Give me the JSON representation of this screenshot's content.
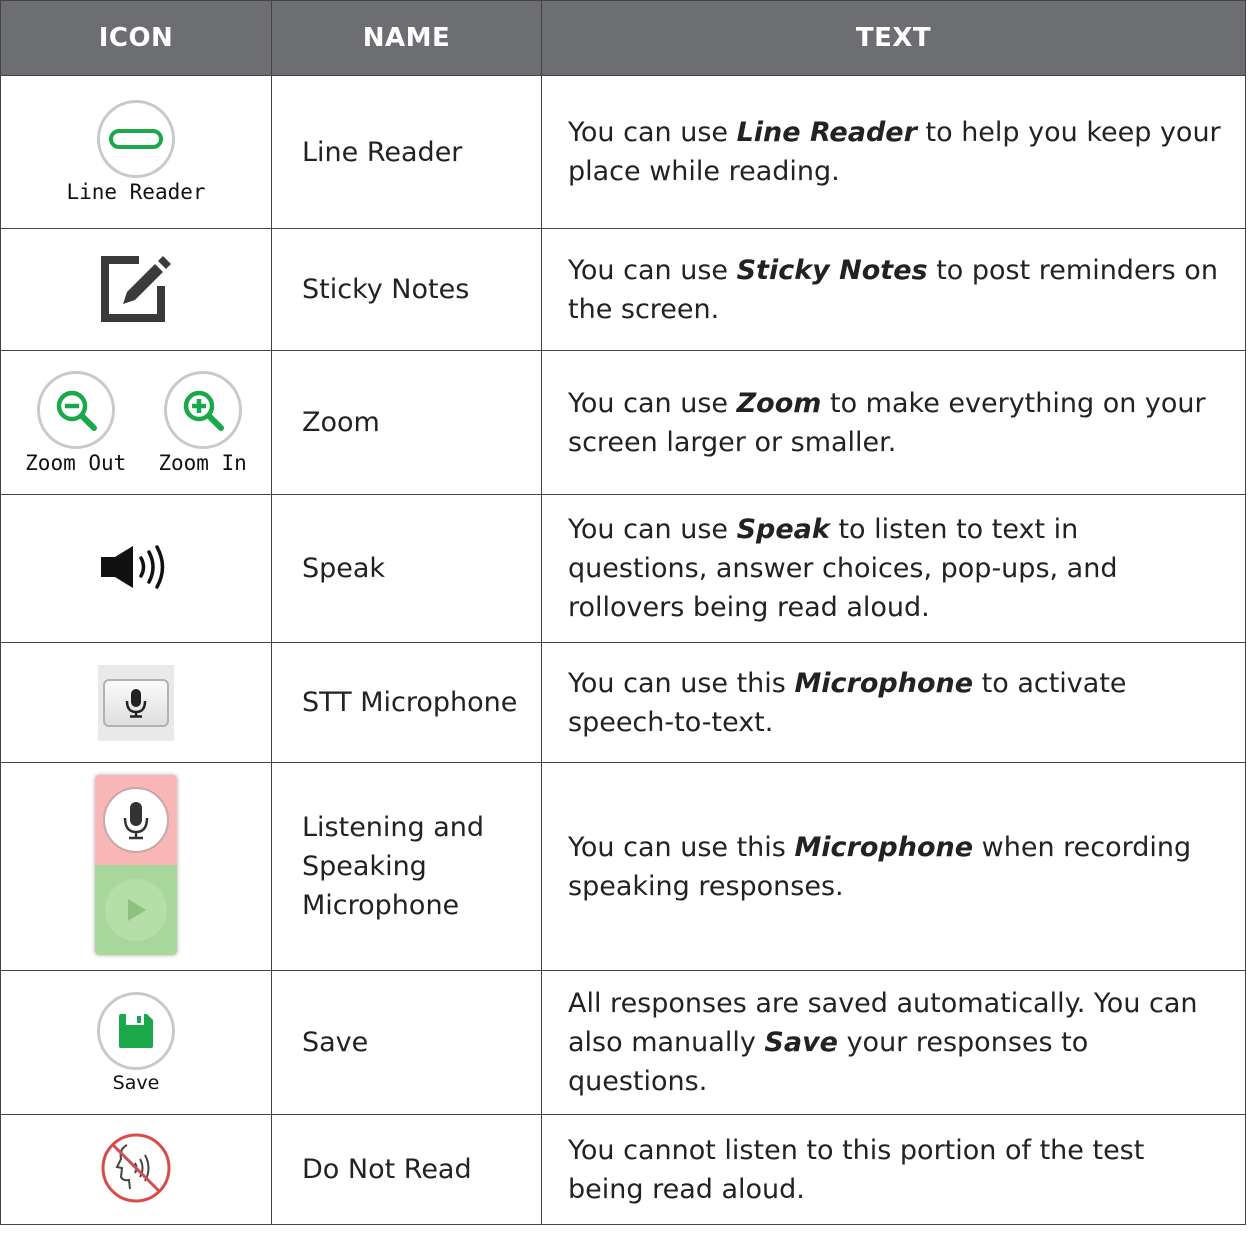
{
  "header": {
    "icon": "ICON",
    "name": "NAME",
    "text": "TEXT"
  },
  "colors": {
    "header_bg": "#6d6e71",
    "green": "#1aa84b",
    "border": "#444444"
  },
  "rows": [
    {
      "icon": "line-reader-icon",
      "icon_caption": "Line Reader",
      "name": "Line Reader",
      "text_before": "You can use ",
      "text_bold": "Line Reader",
      "text_after": " to help you keep your place while reading."
    },
    {
      "icon": "edit-pencil-icon",
      "name": "Sticky Notes",
      "text_before": "You can use ",
      "text_bold": "Sticky Notes",
      "text_after": " to post reminders on the screen."
    },
    {
      "icon": "zoom-icons",
      "icon_caption_left": "Zoom Out",
      "icon_caption_right": "Zoom In",
      "name": "Zoom",
      "text_before": "You can use ",
      "text_bold": "Zoom",
      "text_after": " to make everything on your screen larger or smaller."
    },
    {
      "icon": "speaker-icon",
      "name": "Speak",
      "text_before": "You can use ",
      "text_bold": "Speak",
      "text_after": " to listen to text in questions, answer choices, pop-ups, and rollovers being read aloud."
    },
    {
      "icon": "microphone-icon",
      "name": "STT Microphone",
      "text_before": "You can use this ",
      "text_bold": "Microphone",
      "text_after": " to activate speech-to-text."
    },
    {
      "icon": "record-play-icon",
      "name": "Listening and Speaking Microphone",
      "text_before": "You can use this ",
      "text_bold": "Microphone",
      "text_after": " when recording speaking responses."
    },
    {
      "icon": "save-disk-icon",
      "icon_caption": "Save",
      "name": "Save",
      "text_before": "All responses are saved automatically. You can also manually ",
      "text_bold": "Save",
      "text_after": " your responses to questions."
    },
    {
      "icon": "do-not-read-icon",
      "name": "Do Not Read",
      "text": "You cannot listen to this portion of the test being read aloud."
    }
  ]
}
